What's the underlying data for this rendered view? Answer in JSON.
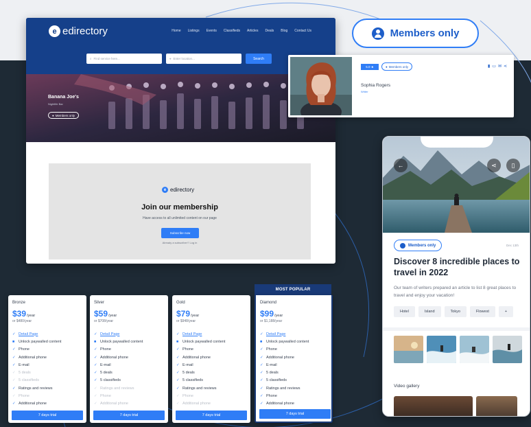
{
  "browser": {
    "logo": "edirectory",
    "nav": [
      "Home",
      "Listings",
      "Events",
      "Classifieds",
      "Articles",
      "Deals",
      "Blog",
      "Contact Us"
    ],
    "search_placeholder": "Find service here...",
    "location_placeholder": "Enter location...",
    "search_button": "Search",
    "venue_name": "Banana Joe's",
    "venue_sub": "Nightlife Bar",
    "members_chip": "Members only",
    "paywall": {
      "logo": "edirectory",
      "title": "Join our membership",
      "subtitle": "Have access to all unlimited content on our page",
      "button": "Subscribe now",
      "login": "Already a subscriber? Log in"
    }
  },
  "callout": {
    "label": "Members only",
    "icon": "user-circle-icon"
  },
  "profile": {
    "rating": "5.0 ★",
    "chip": "Members only",
    "name": "Sophia Rogers",
    "sub": "Writer"
  },
  "phone": {
    "chip": "Members only",
    "date": "Dec 13th",
    "title": "Discover 8 incredible places to travel in 2022",
    "desc": "Our team of writers prepared an article to list 8 great places to travel and enjoy your vacation!",
    "tags": [
      "Hotel",
      "Island",
      "Tokyo",
      "Flowest",
      "+"
    ],
    "video_gallery": "Video gallery"
  },
  "pricing": {
    "most_popular": "MOST POPULAR",
    "plans": [
      {
        "name": "Bronze",
        "price": "$39",
        "per": "/year",
        "alt": "or $480/year",
        "button": "7 days trial",
        "features": [
          {
            "text": "Detail Page",
            "state": "link"
          },
          {
            "text": "Unlock paywalled content",
            "state": "lock"
          },
          {
            "text": "Phone",
            "state": "on"
          },
          {
            "text": "Additional phone",
            "state": "on"
          },
          {
            "text": "E-mail",
            "state": "on"
          },
          {
            "text": "5 deals",
            "state": "off"
          },
          {
            "text": "5 classifieds",
            "state": "off"
          },
          {
            "text": "Ratings and reviews",
            "state": "on"
          },
          {
            "text": "Phone",
            "state": "off"
          },
          {
            "text": "Additional phone",
            "state": "on"
          }
        ]
      },
      {
        "name": "Silver",
        "price": "$59",
        "per": "/year",
        "alt": "or $708/year",
        "button": "7 days trial",
        "features": [
          {
            "text": "Detail Page",
            "state": "link"
          },
          {
            "text": "Unlock paywalled content",
            "state": "lock"
          },
          {
            "text": "Phone",
            "state": "on"
          },
          {
            "text": "Additional phone",
            "state": "on"
          },
          {
            "text": "E-mail",
            "state": "on"
          },
          {
            "text": "5 deals",
            "state": "on"
          },
          {
            "text": "5 classifieds",
            "state": "on"
          },
          {
            "text": "Ratings and reviews",
            "state": "off"
          },
          {
            "text": "Phone",
            "state": "off"
          },
          {
            "text": "Additional phone",
            "state": "off"
          }
        ]
      },
      {
        "name": "Gold",
        "price": "$79",
        "per": "/year",
        "alt": "or $948/year",
        "button": "7 days trial",
        "features": [
          {
            "text": "Detail Page",
            "state": "link"
          },
          {
            "text": "Unlock paywalled content",
            "state": "lock"
          },
          {
            "text": "Phone",
            "state": "on"
          },
          {
            "text": "Additional phone",
            "state": "on"
          },
          {
            "text": "E-mail",
            "state": "on"
          },
          {
            "text": "5 deals",
            "state": "on"
          },
          {
            "text": "5 classifieds",
            "state": "on"
          },
          {
            "text": "Ratings and reviews",
            "state": "on"
          },
          {
            "text": "Phone",
            "state": "off"
          },
          {
            "text": "Additional phone",
            "state": "off"
          }
        ]
      },
      {
        "name": "Diamond",
        "price": "$99",
        "per": "/year",
        "alt": "or $1,188/year",
        "button": "7 days trial",
        "features": [
          {
            "text": "Detail Page",
            "state": "link"
          },
          {
            "text": "Unlock paywalled content",
            "state": "lock"
          },
          {
            "text": "Phone",
            "state": "on"
          },
          {
            "text": "Additional phone",
            "state": "on"
          },
          {
            "text": "E-mail",
            "state": "on"
          },
          {
            "text": "5 deals",
            "state": "on"
          },
          {
            "text": "5 classifieds",
            "state": "on"
          },
          {
            "text": "Ratings and reviews",
            "state": "on"
          },
          {
            "text": "Phone",
            "state": "on"
          },
          {
            "text": "Additional phone",
            "state": "on"
          }
        ]
      }
    ]
  },
  "colors": {
    "accent": "#2f7df6",
    "brand_dark": "#15408a",
    "popular": "#193a78",
    "background_dark": "#1e2a35"
  }
}
